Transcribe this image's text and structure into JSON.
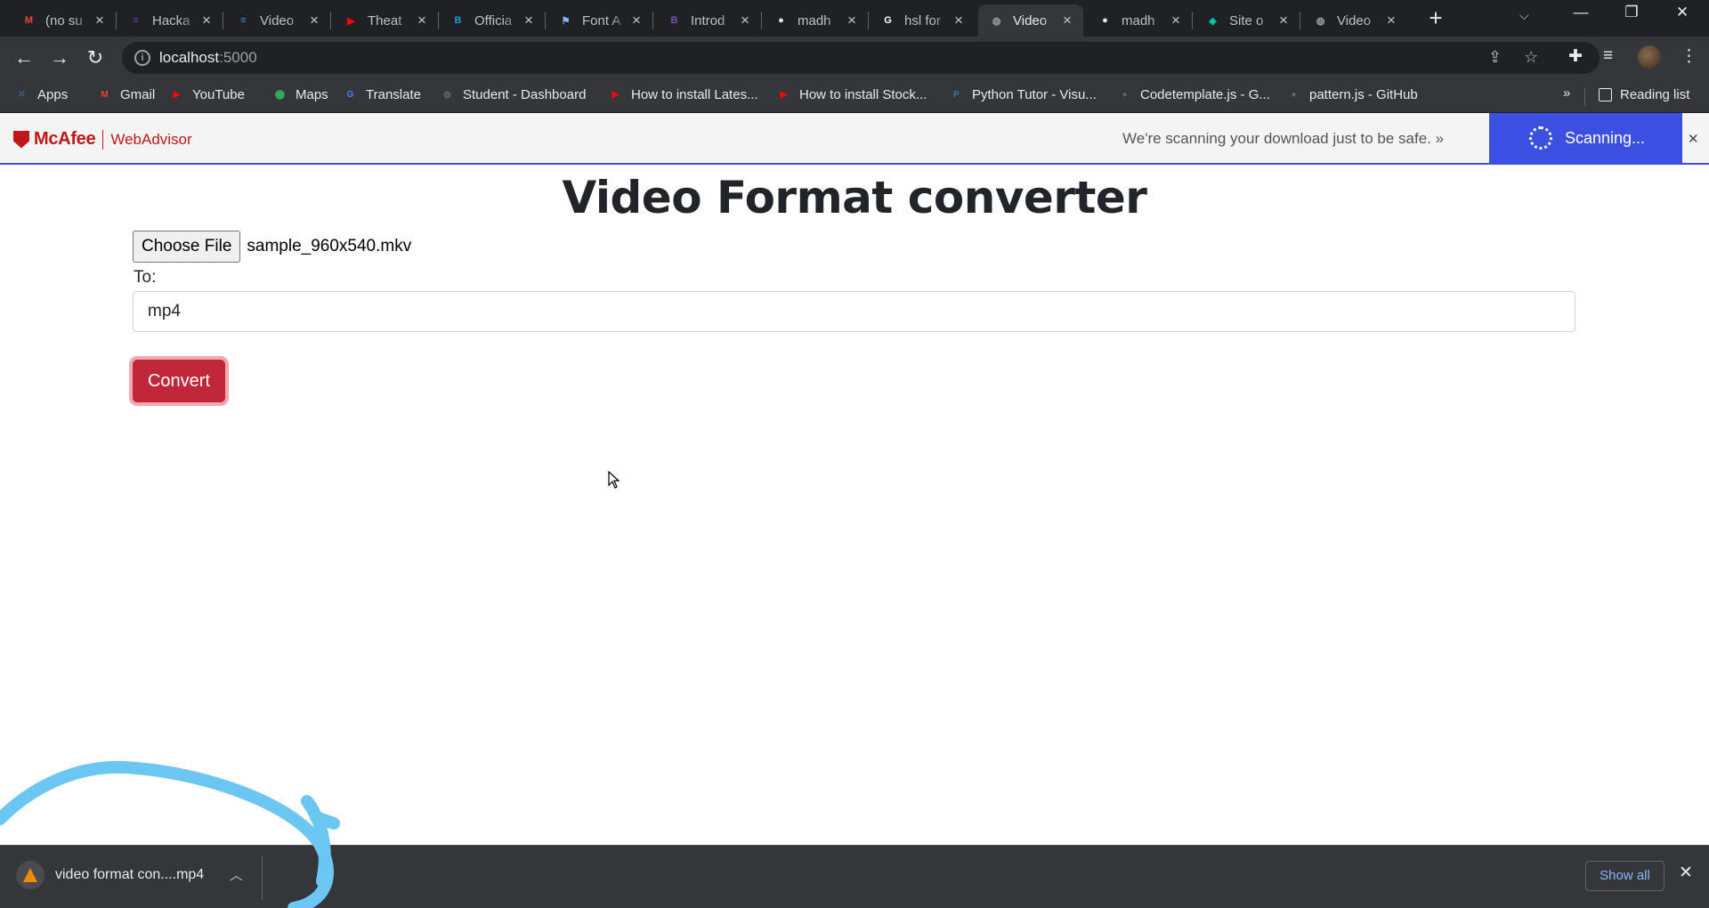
{
  "browser": {
    "tabs": [
      {
        "title": "(no su",
        "icon": "gmail-icon",
        "color": "#ea4335",
        "letter": "M",
        "active": false
      },
      {
        "title": "Hacka",
        "icon": "forms-icon",
        "color": "#673ab7",
        "letter": "≡",
        "active": false
      },
      {
        "title": "Video",
        "icon": "docs-icon",
        "color": "#4285f4",
        "letter": "≡",
        "active": false
      },
      {
        "title": "Theat",
        "icon": "youtube-icon",
        "color": "#ff0000",
        "letter": "▶",
        "active": false
      },
      {
        "title": "Officia",
        "icon": "bootstrap-icon",
        "color": "#1e9ad6",
        "letter": "B",
        "active": false
      },
      {
        "title": "Font A",
        "icon": "flag-icon",
        "color": "#8ab4f8",
        "letter": "⚑",
        "active": false
      },
      {
        "title": "Introd",
        "icon": "bootstrap-icon",
        "color": "#7952b3",
        "letter": "B",
        "active": false
      },
      {
        "title": "madh",
        "icon": "github-icon",
        "color": "#e8eaed",
        "letter": "●",
        "active": false
      },
      {
        "title": "hsl for",
        "icon": "google-icon",
        "color": "#ffffff",
        "letter": "G",
        "active": false
      },
      {
        "title": "Video",
        "icon": "globe-icon",
        "color": "#9aa0a6",
        "letter": "◍",
        "active": true
      },
      {
        "title": "madh",
        "icon": "github-icon",
        "color": "#e8eaed",
        "letter": "●",
        "active": false
      },
      {
        "title": "Site o",
        "icon": "diamond-icon",
        "color": "#00c4a7",
        "letter": "◆",
        "active": false
      },
      {
        "title": "Video",
        "icon": "globe-icon",
        "color": "#9aa0a6",
        "letter": "◍",
        "active": false
      }
    ],
    "new_tab": "+",
    "url_host": "localhost",
    "url_port": ":5000",
    "bookmarks": [
      {
        "label": "Apps",
        "icon": "apps-grid-icon",
        "color": "#4285f4",
        "glyph": "⁙"
      },
      {
        "label": "Gmail",
        "icon": "gmail-icon",
        "color": "#ea4335",
        "glyph": "M"
      },
      {
        "label": "YouTube",
        "icon": "youtube-icon",
        "color": "#ff0000",
        "glyph": "▶"
      },
      {
        "label": "Maps",
        "icon": "maps-pin-icon",
        "color": "#34a853",
        "glyph": "⬤"
      },
      {
        "label": "Translate",
        "icon": "translate-icon",
        "color": "#4285f4",
        "glyph": "G"
      },
      {
        "label": "Student - Dashboard",
        "icon": "globe-icon",
        "color": "#5f6368",
        "glyph": "◍"
      },
      {
        "label": "How to install Lates...",
        "icon": "youtube-icon",
        "color": "#ff0000",
        "glyph": "▶"
      },
      {
        "label": "How to install Stock...",
        "icon": "youtube-icon",
        "color": "#ff0000",
        "glyph": "▶"
      },
      {
        "label": "Python Tutor - Visu...",
        "icon": "python-icon",
        "color": "#3776ab",
        "glyph": "P"
      },
      {
        "label": "Codetemplate.js - G...",
        "icon": "github-icon",
        "color": "#5f6368",
        "glyph": "●"
      },
      {
        "label": "pattern.js - GitHub",
        "icon": "github-icon",
        "color": "#5f6368",
        "glyph": "●"
      }
    ],
    "bookmarks_more": "»",
    "reading_list": "Reading list"
  },
  "mcafee": {
    "brand": "McAfee",
    "product": "WebAdvisor",
    "message": "We're scanning your download just to be safe. »",
    "status": "Scanning..."
  },
  "page": {
    "title": "Video Format converter",
    "choose_file_label": "Choose File",
    "file_name": "sample_960x540.mkv",
    "to_label": "To:",
    "format_value": "mp4",
    "convert_label": "Convert"
  },
  "download_shelf": {
    "file_label": "video format con....mp4",
    "show_all": "Show all"
  },
  "colors": {
    "convert_button": "#c0283a",
    "mcafee_red": "#c01818",
    "mcafee_blue": "#3b4fe0"
  }
}
